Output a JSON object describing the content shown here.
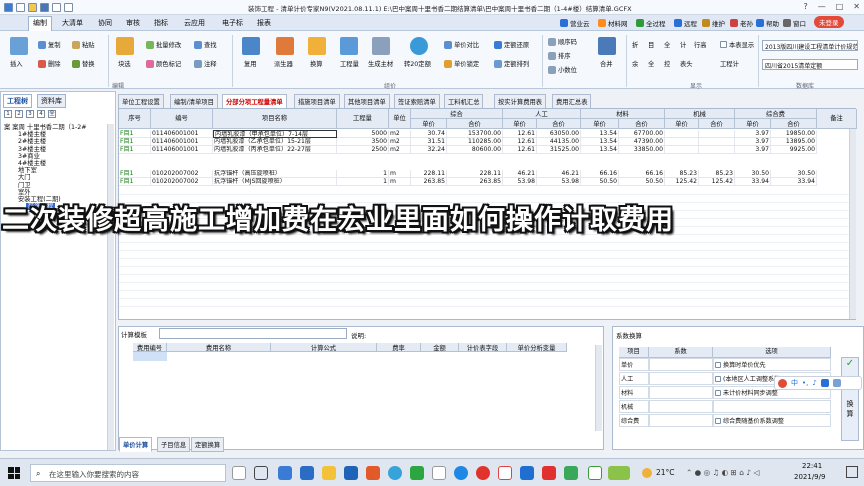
{
  "app": {
    "title": "装饰工程 - 清单计价专家N9(V2021.08.11.1) E:\\巴中案周十里书香二期结算清单\\巴中案周十里书香二期（1-4#楼）结算清单.GCFX",
    "winbtns": [
      "?",
      "—",
      "□",
      "✕"
    ]
  },
  "menu": {
    "items": [
      "编制",
      "大清单",
      "协同",
      "审核",
      "指标",
      "云应用",
      "电子标",
      "报表"
    ],
    "right": [
      {
        "label": "营业云",
        "color": "#2a6fd6"
      },
      {
        "label": "材料网",
        "color": "#ff8c1a"
      },
      {
        "label": "全过程",
        "color": "#2e9a3a"
      },
      {
        "label": "远程",
        "color": "#2a6fd6"
      },
      {
        "label": "维护",
        "color": "#c28a1a"
      },
      {
        "label": "老孙",
        "color": "#d04040"
      },
      {
        "label": "帮助",
        "color": "#2a6fd6"
      },
      {
        "label": "窗口",
        "color": "#666666"
      }
    ],
    "badge": "未登录"
  },
  "ribbon": {
    "g1": [
      "插入",
      "复制",
      "粘贴",
      "删除",
      "替换"
    ],
    "g2": [
      "块选",
      "批量修改",
      "查找",
      "颜色标记",
      "注释"
    ],
    "g3": [
      "复用",
      "派生器",
      "换算",
      "工程量",
      "生成主材",
      "转20定额"
    ],
    "g4": [
      "单价对比",
      "定额还原",
      "单价锁定",
      "定额排列"
    ],
    "g5": [
      "顺序码",
      "排序",
      "小数位",
      "合并"
    ],
    "g6": [
      "折",
      "目",
      "全",
      "计",
      "行高",
      "本表显示",
      "余",
      "全",
      "控",
      "表头",
      "工程计"
    ],
    "groups": [
      "编辑",
      "组价",
      "显示",
      "数据库"
    ],
    "combos": [
      "2013版四川建设工程清单计价规范项目",
      "四川省2015清单定额"
    ]
  },
  "left": {
    "tabs": [
      "工程树",
      "资料库"
    ],
    "levels": [
      "1",
      "2",
      "3",
      "4",
      "全"
    ],
    "tree": [
      "案 案周 十里书香二期（1-2#",
      "1#楼主楼",
      "2#楼主楼",
      "3#楼主楼",
      "3#商业",
      "4#楼主楼",
      "地下室",
      "大门",
      "门卫",
      "室外",
      "安装工程(二期)",
      "装饰工程"
    ]
  },
  "doctabs": [
    "单位工程设置",
    "编制/清单项目",
    "分部分项工程量清单",
    "措施项目清单",
    "其他项目清单",
    "签证索赔清单",
    "工料机汇总",
    "按实计算费用表",
    "费用汇总表"
  ],
  "grid": {
    "headers": {
      "seq": "序号",
      "code": "编号",
      "name": "项目名称",
      "qty": "工程量",
      "unit": "单位",
      "g1": "综合",
      "g2": "人工",
      "g3": "材料",
      "g4": "机械",
      "g5": "综合费",
      "sub": [
        "单价",
        "合价",
        "单价",
        "合价",
        "单价",
        "合价",
        "单价",
        "合价",
        "单价",
        "合价"
      ],
      "last": "备注"
    },
    "rows": [
      {
        "seq": "F目1",
        "code": "011406001001",
        "name": "内墙乳胶漆（甲承包单位）7-14层",
        "qty": "5000",
        "unit": "m2",
        "v": [
          "30.74",
          "153700.00",
          "12.61",
          "63050.00",
          "13.54",
          "67700.00",
          "",
          "",
          "3.97",
          "19850.00"
        ]
      },
      {
        "seq": "F目1",
        "code": "011406001001",
        "name": "内墙乳胶漆（乙承包单位）15-21层",
        "qty": "3500",
        "unit": "m2",
        "v": [
          "31.51",
          "110285.00",
          "12.61",
          "44135.00",
          "13.54",
          "47390.00",
          "",
          "",
          "3.97",
          "13895.00"
        ]
      },
      {
        "seq": "F目1",
        "code": "011406001001",
        "name": "内墙乳胶漆（丙承包单位）22-27层",
        "qty": "2500",
        "unit": "m2",
        "v": [
          "32.24",
          "80600.00",
          "12.61",
          "31525.00",
          "13.54",
          "33850.00",
          "",
          "",
          "3.97",
          "9925.00"
        ]
      },
      {
        "seq": "F目1",
        "code": "010202007002",
        "name": "抗浮锚杆（高压旋喷桩）",
        "qty": "1",
        "unit": "m",
        "v": [
          "228.11",
          "228.11",
          "46.21",
          "46.21",
          "66.16",
          "66.16",
          "85.23",
          "85.23",
          "30.50",
          "30.50"
        ]
      },
      {
        "seq": "F目1",
        "code": "010202007002",
        "name": "抗浮锚杆（MJS回旋喷桩）",
        "qty": "1",
        "unit": "m",
        "v": [
          "263.85",
          "263.85",
          "53.98",
          "53.98",
          "50.50",
          "50.50",
          "125.42",
          "125.42",
          "33.94",
          "33.94"
        ]
      }
    ]
  },
  "overlay": "二次装修超高施工增加费在宏业里面如何操作计取费用",
  "bottom": {
    "label": "计算模板",
    "desc": "说明:",
    "headers": [
      "费用编号",
      "费用名称",
      "计算公式",
      "费率",
      "金额",
      "计价表字段",
      "单价分析变量"
    ],
    "tabs": [
      "单价计算",
      "子目信息",
      "定额换算"
    ]
  },
  "rb": {
    "title": "系数换算",
    "headers": [
      "项目",
      "系数",
      "选项"
    ],
    "rows": [
      "单价",
      "人工",
      "材料",
      "机械",
      "综合费"
    ],
    "opts": [
      "换算时单价优先",
      "(本地区人工调整系数)",
      "未计价材料同步调整",
      "",
      "综合费随基价系数调整"
    ],
    "side": [
      "换",
      "算"
    ]
  },
  "taskbar": {
    "search": "在这里输入你要搜索的内容",
    "weather": "21°C",
    "time": "22:41",
    "date": "2021/9/9",
    "ime": "中"
  }
}
